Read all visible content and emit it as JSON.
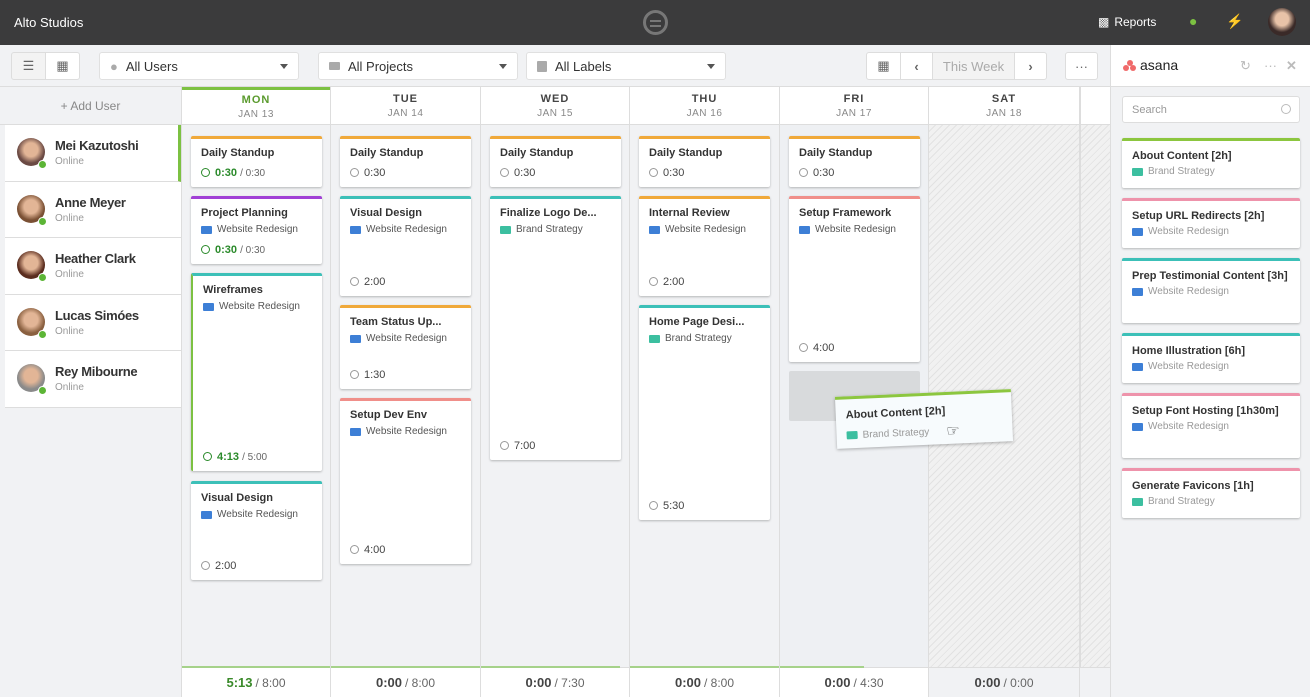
{
  "app": {
    "title": "Alto Studios",
    "reports_label": "Reports",
    "icons": [
      "reports-icon",
      "user-icon",
      "bolt-icon"
    ]
  },
  "toolbar": {
    "users_filter": "All Users",
    "projects_filter": "All Projects",
    "labels_filter": "All Labels",
    "week_label": "This Week",
    "more": "···"
  },
  "sidebar": {
    "add_user": "+ Add User",
    "users": [
      {
        "name": "Mei Kazutoshi",
        "status": "Online",
        "active": true,
        "color": "#6b4a44"
      },
      {
        "name": "Anne Meyer",
        "status": "Online",
        "color": "#7a5034"
      },
      {
        "name": "Heather Clark",
        "status": "Online",
        "color": "#5a2c1e"
      },
      {
        "name": "Lucas Simóes",
        "status": "Online",
        "color": "#8a6040"
      },
      {
        "name": "Rey Mibourne",
        "status": "Online",
        "color": "#8a8a8a"
      }
    ]
  },
  "colors": {
    "orange": "#f0a93a",
    "purple": "#a141d6",
    "teal": "#3cc0b8",
    "pink": "#f08f8a",
    "green": "#8cc63f",
    "rose": "#ee93ab",
    "accent": "#7cc142"
  },
  "days": [
    {
      "day": "MON",
      "date": "JAN 13",
      "logged": "5:13",
      "capacity": "8:00",
      "fill": 1,
      "today": true,
      "cards": [
        {
          "title": "Daily Standup",
          "color": "orange",
          "logged": "0:30",
          "dur": "0:30"
        },
        {
          "title": "Project Planning",
          "color": "purple",
          "project": "Website Redesign",
          "logged": "0:30",
          "dur": "0:30"
        },
        {
          "title": "Wireframes",
          "color": "teal",
          "project": "Website Redesign",
          "logged": "4:13",
          "dur": "5:00"
        },
        {
          "title": "Visual Design",
          "color": "teal",
          "project": "Website Redesign",
          "dur": "2:00"
        }
      ]
    },
    {
      "day": "TUE",
      "date": "JAN 14",
      "logged": "0:00",
      "capacity": "8:00",
      "fill": 1,
      "cards": [
        {
          "title": "Daily Standup",
          "color": "orange",
          "dur": "0:30"
        },
        {
          "title": "Visual Design",
          "color": "teal",
          "project": "Website Redesign",
          "dur": "2:00"
        },
        {
          "title": "Team Status Up...",
          "color": "orange",
          "project": "Website Redesign",
          "dur": "1:30"
        },
        {
          "title": "Setup Dev Env",
          "color": "pink",
          "project": "Website Redesign",
          "dur": "4:00"
        }
      ]
    },
    {
      "day": "WED",
      "date": "JAN 15",
      "logged": "0:00",
      "capacity": "7:30",
      "fill": 0.94,
      "cards": [
        {
          "title": "Daily Standup",
          "color": "orange",
          "dur": "0:30"
        },
        {
          "title": "Finalize Logo De...",
          "color": "teal",
          "project": "Brand Strategy",
          "dur": "7:00"
        }
      ]
    },
    {
      "day": "THU",
      "date": "JAN 16",
      "logged": "0:00",
      "capacity": "8:00",
      "fill": 1,
      "cards": [
        {
          "title": "Daily Standup",
          "color": "orange",
          "dur": "0:30"
        },
        {
          "title": "Internal Review",
          "color": "orange",
          "project": "Website Redesign",
          "dur": "2:00"
        },
        {
          "title": "Home Page Desi...",
          "color": "teal",
          "project": "Brand Strategy",
          "dur": "5:30"
        }
      ]
    },
    {
      "day": "FRI",
      "date": "JAN 17",
      "logged": "0:00",
      "capacity": "4:30",
      "fill": 0.57,
      "cards": [
        {
          "title": "Daily Standup",
          "color": "orange",
          "dur": "0:30"
        },
        {
          "title": "Setup Framework",
          "color": "pink",
          "project": "Website Redesign",
          "dur": "4:00"
        }
      ]
    },
    {
      "day": "SAT",
      "date": "JAN 18",
      "logged": "0:00",
      "capacity": "0:00",
      "fill": 0,
      "cards": []
    }
  ],
  "dragging": {
    "title": "About Content [2h]",
    "project": "Brand Strategy"
  },
  "panel": {
    "brand": "asana",
    "search_placeholder": "Search",
    "tasks": [
      {
        "title": "About Content [2h]",
        "project": "Brand Strategy",
        "color": "green"
      },
      {
        "title": "Setup URL Redirects [2h]",
        "project": "Website Redesign",
        "color": "rose"
      },
      {
        "title": "Prep Testimonial Content [3h]",
        "project": "Website Redesign",
        "color": "teal"
      },
      {
        "title": "Home Illustration [6h]",
        "project": "Website Redesign",
        "color": "teal"
      },
      {
        "title": "Setup Font Hosting [1h30m]",
        "project": "Website Redesign",
        "color": "rose"
      },
      {
        "title": "Generate Favicons [1h]",
        "project": "Brand Strategy",
        "color": "rose"
      }
    ]
  }
}
